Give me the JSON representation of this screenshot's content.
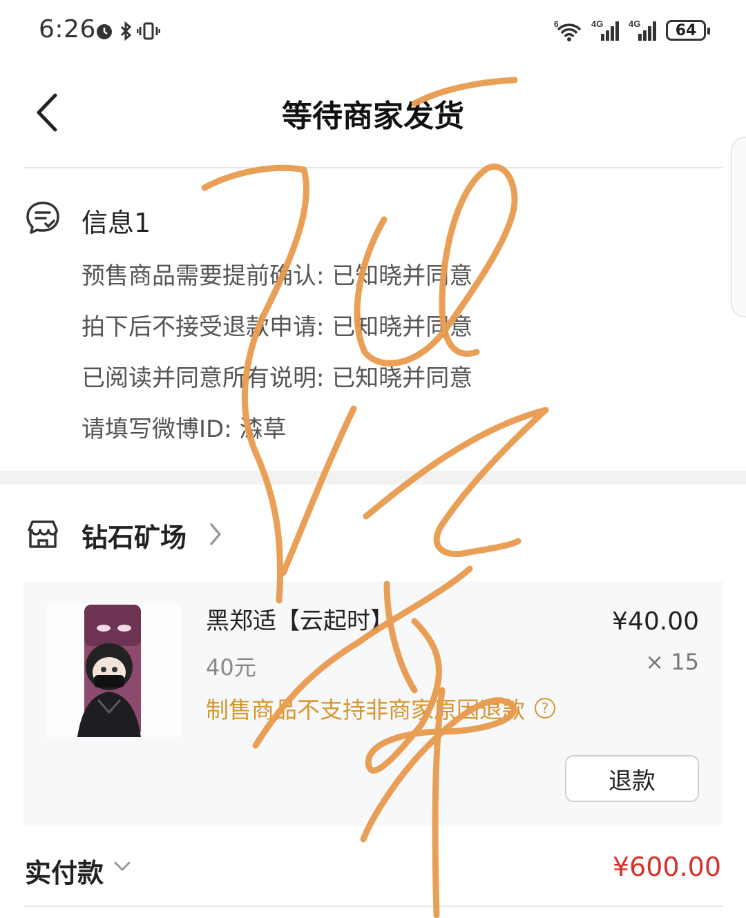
{
  "status_bar": {
    "time": "6:26",
    "battery": "64",
    "net1": "4G",
    "net2": "4G",
    "wifi_label": "6"
  },
  "header": {
    "title": "等待商家发货"
  },
  "info": {
    "title": "信息1",
    "rows": [
      {
        "label": "预售商品需要提前确认:",
        "value": "已知晓并同意"
      },
      {
        "label": "拍下后不接受退款申请:",
        "value": "已知晓并同意"
      },
      {
        "label": "已阅读并同意所有说明:",
        "value": "已知晓并同意"
      },
      {
        "label": "请填写微博ID:",
        "value": "潹草"
      }
    ]
  },
  "shop": {
    "name": "钻石矿场"
  },
  "product": {
    "name": "黑郑适【云起时】",
    "price": "¥40.00",
    "spec": "40元",
    "quantity": "× 15",
    "note": "制售商品不支持非商家原因退款",
    "refund_label": "退款"
  },
  "total": {
    "label": "实付款",
    "value": "¥600.00"
  },
  "colors": {
    "accent_orange": "#d8952d",
    "price_red": "#d9302c",
    "scribble": "#e89a4c"
  }
}
